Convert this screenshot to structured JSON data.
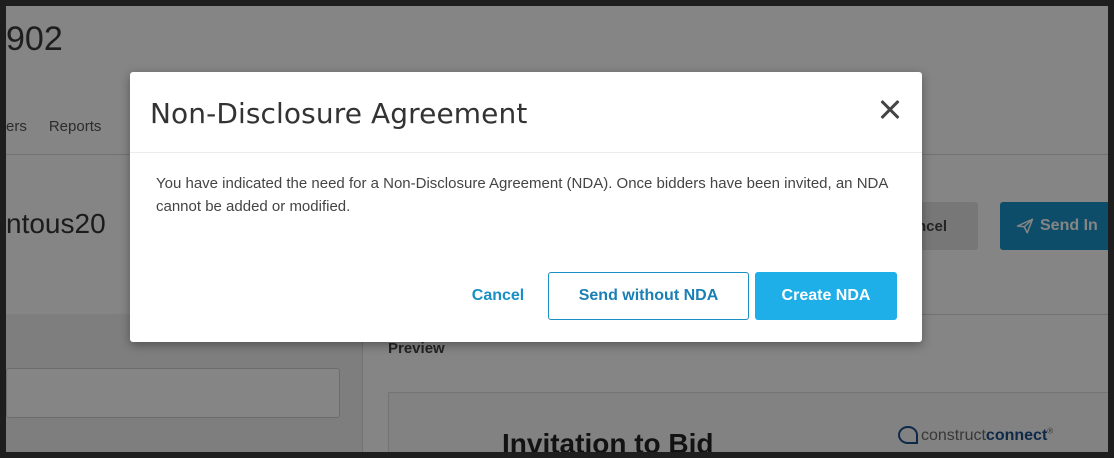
{
  "background": {
    "page_title_fragment": "902",
    "nav_items": [
      "ers",
      "Reports"
    ],
    "project_fragment": "ntous20",
    "cancel_fragment": "ncel",
    "send_fragment": "Send In",
    "preview_label": "Preview",
    "invitation_title": "Invitation to Bid",
    "logo": {
      "part1": "construct",
      "part2": "connect",
      "mark": "®"
    }
  },
  "modal": {
    "title": "Non-Disclosure Agreement",
    "body": "You have indicated the need for a Non-Disclosure Agreement (NDA). Once bidders have been invited, an NDA cannot be added or modified.",
    "buttons": {
      "cancel": "Cancel",
      "send_without_nda": "Send without NDA",
      "create_nda": "Create NDA"
    }
  },
  "colors": {
    "primary": "#1eaee8",
    "link": "#1a8fc4",
    "overlay_dim": "#7a7a7a"
  },
  "icons": {
    "close": "close-icon",
    "send": "paper-plane-icon",
    "logo": "constructconnect-logo-icon"
  }
}
